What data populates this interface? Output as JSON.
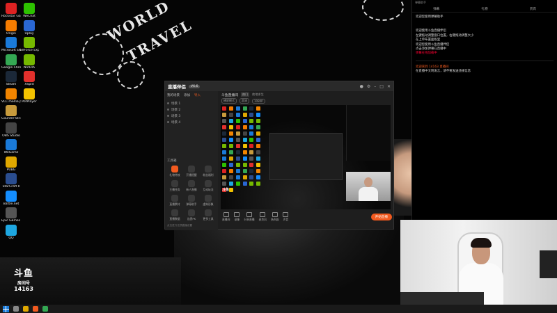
{
  "desktop": {
    "icons": [
      {
        "label": "Rockstar Games",
        "color": "#d22"
      },
      {
        "label": "Origin",
        "color": "#f57c00"
      },
      {
        "label": "Microsoft Edge",
        "color": "#1a7ad9"
      },
      {
        "label": "Google Chrome",
        "color": "#34a853"
      },
      {
        "label": "Steam",
        "color": "#1b2838"
      },
      {
        "label": "VLC media player",
        "color": "#f28500"
      },
      {
        "label": "Counter-Strike Global Off...",
        "color": "#c89b3c"
      },
      {
        "label": "OBS Studio",
        "color": "#444"
      },
      {
        "label": "WeGame",
        "color": "#1a7ad9"
      },
      {
        "label": "PUBG",
        "color": "#e0a800"
      },
      {
        "label": "StarCraft II",
        "color": "#2a4d8f"
      },
      {
        "label": "Battle.net",
        "color": "#148eff"
      },
      {
        "label": "Epic Games Launcher",
        "color": "#555"
      },
      {
        "label": "QQ",
        "color": "#1ea7e1"
      },
      {
        "label": "WeChat",
        "color": "#2dc100"
      },
      {
        "label": "Uplay",
        "color": "#2a67d3"
      },
      {
        "label": "GeForce Experience",
        "color": "#76b900"
      },
      {
        "label": "NVIDIA",
        "color": "#76b900"
      },
      {
        "label": "XSplit",
        "color": "#e2302c"
      },
      {
        "label": "PotPlayer",
        "color": "#f2c200"
      }
    ],
    "wall_text_1": "WORLD",
    "wall_text_2": "TRAVEL"
  },
  "douyu": {
    "brand": "斗鱼",
    "room_label": "房间号",
    "room_number": "14163"
  },
  "app": {
    "logo": "直播伴侣",
    "version": "V6.6",
    "tabs": [
      "我的场景",
      "添加",
      "导入"
    ],
    "scenes": [
      "场景 1",
      "场景 2",
      "场景 3",
      "场景 4"
    ],
    "tools_title": "工具箱",
    "tools": [
      {
        "label": "礼物特效"
      },
      {
        "label": "开播提醒"
      },
      {
        "label": "粉丝福利"
      },
      {
        "label": "主播任务"
      },
      {
        "label": "新人直播"
      },
      {
        "label": "互动玩法"
      },
      {
        "label": "直播素材"
      },
      {
        "label": "弹幕助手"
      },
      {
        "label": "虚拟形象"
      },
      {
        "label": "直播数据"
      },
      {
        "label": "连麦PK"
      },
      {
        "label": "更多工具"
      }
    ],
    "left_tip": "点击进行无损直播设置",
    "room_title": "斗鱼直播间",
    "room_tag": "热门",
    "room_category": "绝地求生",
    "sub_mode": "横屏模式",
    "sub_quality": "超清",
    "sub_fps": "1080P",
    "preview_logo": "斗鱼",
    "controls": [
      {
        "label": "直播间"
      },
      {
        "label": "录像"
      },
      {
        "label": "分享直播"
      },
      {
        "label": "麦克风"
      },
      {
        "label": "扬声器"
      },
      {
        "label": "声音"
      }
    ],
    "start_button": "开始直播"
  },
  "side": {
    "header": "弹幕助手",
    "tabs": [
      "弹幕",
      "礼物",
      "贵宾"
    ],
    "messages": [
      "欢迎您使用弹幕助手",
      "欢迎使用斗鱼直播伴侣",
      "左键拖动调整窗口位置，右键拖动调整大小",
      "在上单布置面板里",
      "欢迎您使用斗鱼直播伴侣",
      "点击添加弹幕在直播中",
      "弹幕在线加载中"
    ],
    "notice": "欢迎来到 14163 直播间",
    "notice_2": "在直播中文明发言，请不要发送违规信息"
  }
}
